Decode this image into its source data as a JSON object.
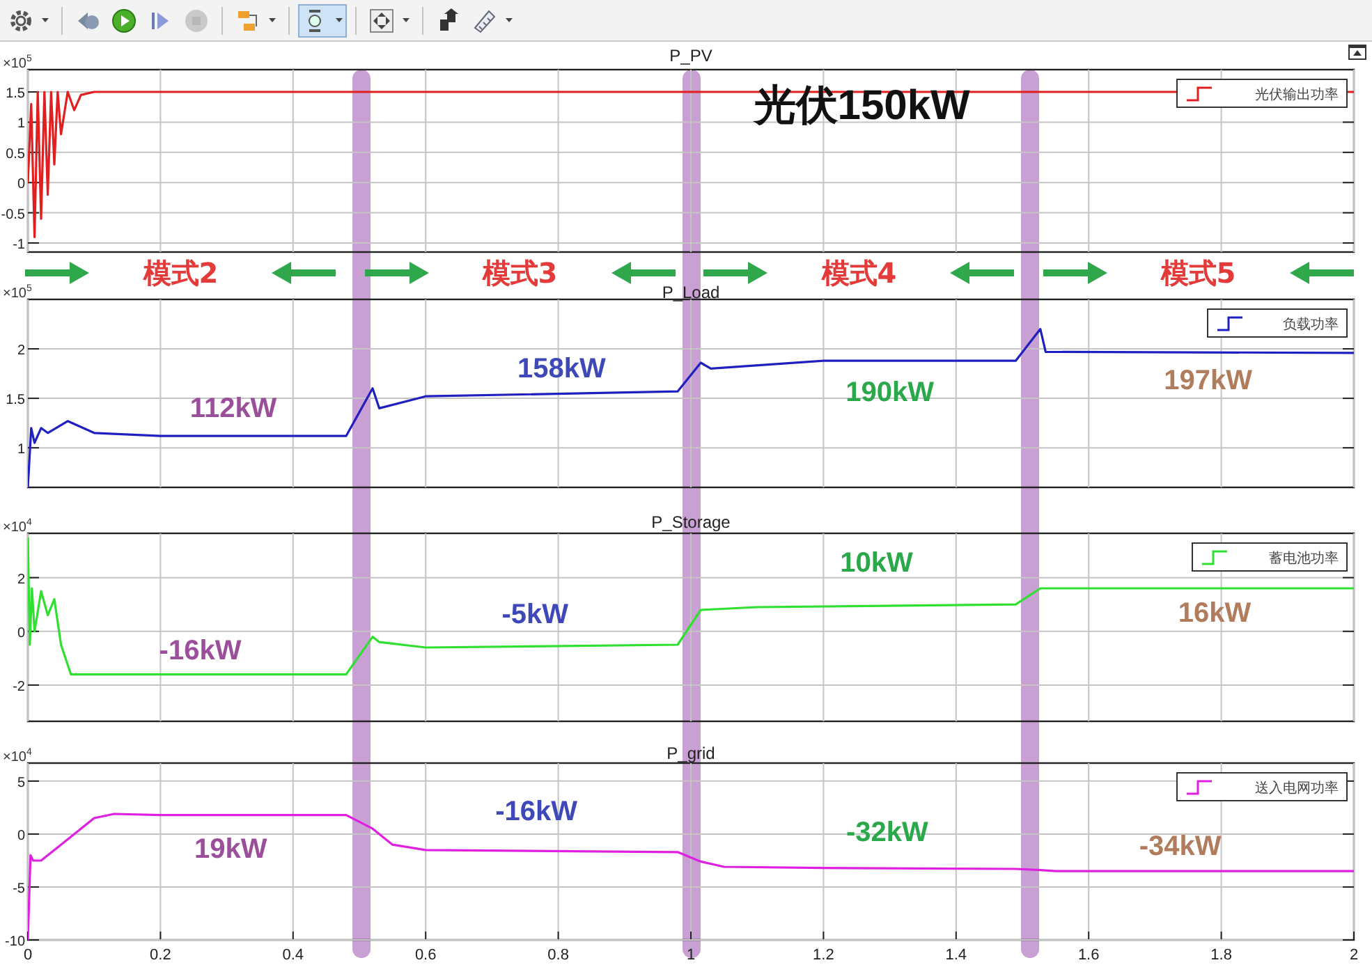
{
  "toolbar": [
    {
      "kind": "settings",
      "selected": false,
      "dropdown": true,
      "disabled": false
    },
    {
      "kind": "separator"
    },
    {
      "kind": "step_back",
      "selected": false,
      "dropdown": false,
      "disabled": false
    },
    {
      "kind": "run",
      "selected": false,
      "dropdown": false,
      "disabled": false
    },
    {
      "kind": "step_forward",
      "selected": false,
      "dropdown": false,
      "disabled": false
    },
    {
      "kind": "stop",
      "selected": false,
      "dropdown": false,
      "disabled": true
    },
    {
      "kind": "separator"
    },
    {
      "kind": "blocks",
      "selected": false,
      "dropdown": true,
      "disabled": false
    },
    {
      "kind": "separator"
    },
    {
      "kind": "zoom",
      "selected": true,
      "dropdown": true,
      "disabled": false
    },
    {
      "kind": "separator"
    },
    {
      "kind": "fit",
      "selected": false,
      "dropdown": true,
      "disabled": false
    },
    {
      "kind": "separator"
    },
    {
      "kind": "triggers",
      "selected": false,
      "dropdown": false,
      "disabled": false
    },
    {
      "kind": "measure",
      "selected": false,
      "dropdown": true,
      "disabled": false
    }
  ],
  "plots": [
    {
      "title": "P_PV",
      "scale": "×10$^{5}$",
      "labels": [
        {
          "kind": "headline",
          "text": "光伏150kW",
          "color": "#111111"
        }
      ],
      "chart_data": {
        "type": "line",
        "xlim": [
          0,
          2
        ],
        "ylim": [
          -1.15,
          1.87
        ],
        "yticks": [
          -1,
          -0.5,
          0,
          0.5,
          1,
          1.5
        ],
        "grid": true,
        "x": [
          0,
          0.005,
          0.01,
          0.015,
          0.02,
          0.025,
          0.03,
          0.035,
          0.04,
          0.045,
          0.05,
          0.06,
          0.07,
          0.08,
          0.1,
          2
        ],
        "series": [
          {
            "name": "光伏输出功率",
            "color": "#e02020",
            "values": [
              0,
              1.3,
              -0.9,
              1.5,
              -0.6,
              1.5,
              -0.2,
              1.5,
              0.3,
              1.5,
              0.8,
              1.5,
              1.2,
              1.45,
              1.5,
              1.5
            ]
          }
        ]
      }
    },
    {
      "title": "P_Load",
      "scale": "×10$^{5}$",
      "labels": [
        {
          "kind": "value",
          "text": "112kW",
          "color": "#9b4f9b"
        },
        {
          "kind": "value",
          "text": "158kW",
          "color": "#3f48b8"
        },
        {
          "kind": "value",
          "text": "190kW",
          "color": "#2aa84a"
        },
        {
          "kind": "value",
          "text": "197kW",
          "color": "#b07c5c"
        }
      ],
      "chart_data": {
        "type": "line",
        "xlim": [
          0,
          2
        ],
        "ylim": [
          0.6,
          2.5
        ],
        "yticks": [
          1,
          1.5,
          2
        ],
        "grid": true,
        "x": [
          0,
          0.005,
          0.01,
          0.02,
          0.03,
          0.06,
          0.1,
          0.2,
          0.48,
          0.52,
          0.53,
          0.6,
          0.98,
          1.015,
          1.03,
          1.2,
          1.49,
          1.527,
          1.535,
          2
        ],
        "series": [
          {
            "name": "负载功率",
            "color": "#2020c0",
            "values": [
              0.6,
              1.2,
              1.05,
              1.2,
              1.15,
              1.27,
              1.15,
              1.12,
              1.12,
              1.6,
              1.4,
              1.52,
              1.57,
              1.86,
              1.8,
              1.88,
              1.88,
              2.2,
              1.97,
              1.96
            ]
          }
        ]
      }
    },
    {
      "title": "P_Storage",
      "scale": "×10$^{4}$",
      "labels": [
        {
          "kind": "value",
          "text": "-16kW",
          "color": "#9b4f9b"
        },
        {
          "kind": "value",
          "text": "-5kW",
          "color": "#3f48b8"
        },
        {
          "kind": "value",
          "text": "10kW",
          "color": "#2aa84a"
        },
        {
          "kind": "value",
          "text": "16kW",
          "color": "#b07c5c"
        }
      ],
      "chart_data": {
        "type": "line",
        "xlim": [
          0,
          2
        ],
        "ylim": [
          -3.35,
          3.65
        ],
        "yticks": [
          -2,
          0,
          2
        ],
        "grid": true,
        "x": [
          0,
          0.003,
          0.006,
          0.01,
          0.02,
          0.03,
          0.04,
          0.05,
          0.065,
          0.1,
          0.48,
          0.52,
          0.53,
          0.6,
          0.98,
          1.015,
          1.1,
          1.49,
          1.527,
          2
        ],
        "series": [
          {
            "name": "蓄电池功率",
            "color": "#30e030",
            "values": [
              3.5,
              -0.5,
              1.6,
              0,
              1.5,
              0.6,
              1.2,
              -0.5,
              -1.6,
              -1.6,
              -1.6,
              -0.2,
              -0.4,
              -0.6,
              -0.5,
              0.8,
              0.9,
              1.0,
              1.6,
              1.6
            ]
          }
        ]
      }
    },
    {
      "title": "P_grid",
      "scale": "×10$^{4}$",
      "labels": [
        {
          "kind": "value",
          "text": "19kW",
          "color": "#9b4f9b"
        },
        {
          "kind": "value",
          "text": "-16kW",
          "color": "#3f48b8"
        },
        {
          "kind": "value",
          "text": "-32kW",
          "color": "#2aa84a"
        },
        {
          "kind": "value",
          "text": "-34kW",
          "color": "#b07c5c"
        }
      ],
      "chart_data": {
        "type": "line",
        "xlim": [
          0,
          2
        ],
        "ylim": [
          -10,
          6.7
        ],
        "xticks": [
          0,
          0.2,
          0.4,
          0.6,
          0.8,
          1,
          1.2,
          1.4,
          1.6,
          1.8,
          2
        ],
        "yticks": [
          -10,
          -5,
          0,
          5
        ],
        "grid": true,
        "x": [
          0,
          0.004,
          0.008,
          0.02,
          0.05,
          0.1,
          0.13,
          0.2,
          0.48,
          0.52,
          0.55,
          0.6,
          0.98,
          1.015,
          1.05,
          1.2,
          1.49,
          1.527,
          1.55,
          2
        ],
        "series": [
          {
            "name": "送入电网功率",
            "color": "#e020e0",
            "values": [
              -10,
              -2,
              -2.5,
              -2.5,
              -1,
              1.5,
              1.9,
              1.8,
              1.8,
              0.5,
              -1,
              -1.5,
              -1.7,
              -2.6,
              -3.1,
              -3.2,
              -3.3,
              -3.4,
              -3.5,
              -3.5
            ]
          }
        ]
      }
    }
  ],
  "modes": [
    {
      "label": "模式2"
    },
    {
      "label": "模式3"
    },
    {
      "label": "模式4"
    },
    {
      "label": "模式5"
    }
  ]
}
